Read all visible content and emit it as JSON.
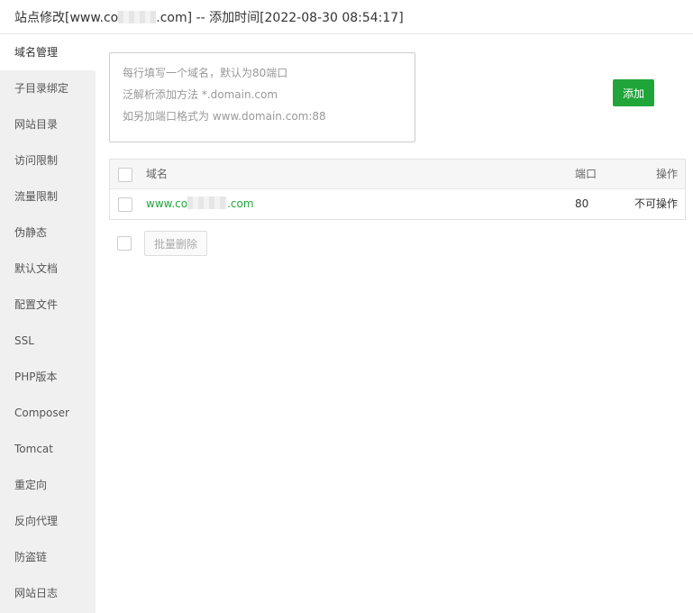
{
  "header": {
    "title_prefix": "站点修改[www.co",
    "title_suffix": ".com] -- 添加时间[2022-08-30 08:54:17]"
  },
  "sidebar": {
    "items": [
      {
        "label": "域名管理"
      },
      {
        "label": "子目录绑定"
      },
      {
        "label": "网站目录"
      },
      {
        "label": "访问限制"
      },
      {
        "label": "流量限制"
      },
      {
        "label": "伪静态"
      },
      {
        "label": "默认文档"
      },
      {
        "label": "配置文件"
      },
      {
        "label": "SSL"
      },
      {
        "label": "PHP版本"
      },
      {
        "label": "Composer"
      },
      {
        "label": "Tomcat"
      },
      {
        "label": "重定向"
      },
      {
        "label": "反向代理"
      },
      {
        "label": "防盗链"
      },
      {
        "label": "网站日志"
      }
    ]
  },
  "domain_input": {
    "placeholder_lines": [
      "每行填写一个域名，默认为80端口",
      "泛解析添加方法 *.domain.com",
      "如另加端口格式为 www.domain.com:88"
    ]
  },
  "toolbar": {
    "add_label": "添加"
  },
  "table": {
    "headers": {
      "domain": "域名",
      "port": "端口",
      "action": "操作"
    },
    "rows": [
      {
        "domain_prefix": "www.co",
        "domain_suffix": ".com",
        "port": "80",
        "action": "不可操作"
      }
    ]
  },
  "bulk": {
    "delete_label": "批量删除"
  },
  "colors": {
    "accent": "#20a53a",
    "sidebar_bg": "#f0f0f0"
  }
}
